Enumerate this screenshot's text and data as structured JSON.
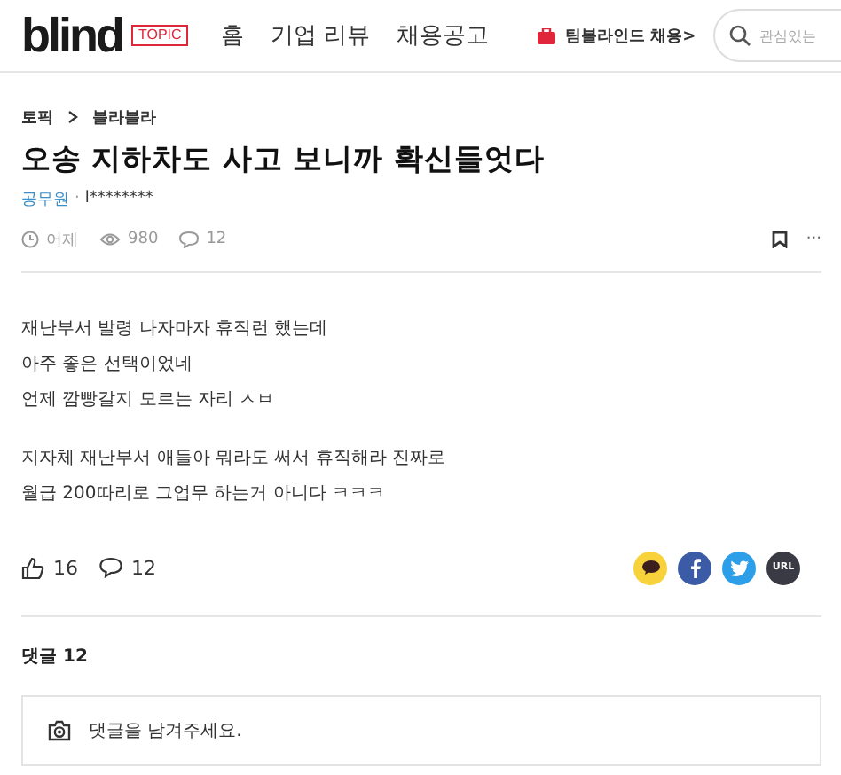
{
  "header": {
    "logo": "blind",
    "logo_tag": "TOPIC",
    "nav": [
      {
        "label": "홈",
        "selected": false
      },
      {
        "label": "기업 리뷰",
        "selected": false
      },
      {
        "label": "채용공고",
        "selected": false
      }
    ],
    "promo": "팀블라인드 채용>",
    "search": {
      "placeholder": "관심있는"
    }
  },
  "breadcrumb": [
    "토픽",
    "블라블라"
  ],
  "title": "오송 지하차도 사고 보니까 확신들엇다",
  "author": {
    "company": "공무원",
    "separator": "·",
    "name": "l********"
  },
  "stats": {
    "time": "어제",
    "views": "980",
    "comments": "12"
  },
  "more": "···",
  "body": [
    [
      "재난부서 발령 나자마자 휴직런 했는데",
      "아주 좋은 선택이었네",
      "언제 깜빵갈지 모르는 자리 ㅅㅂ"
    ],
    [
      "지자체 재난부서 애들아 뭐라도 써서 휴직해라 진짜로",
      "월급 200따리로 그업무 하는거 아니다 ㅋㅋㅋ"
    ]
  ],
  "actions": {
    "likes": "16",
    "comments": "12"
  },
  "share": [
    {
      "kind": "kakao"
    },
    {
      "kind": "facebook"
    },
    {
      "kind": "twitter"
    },
    {
      "kind": "url",
      "label": "URL"
    }
  ],
  "comments_header": "댓글 12",
  "comment_box": {
    "placeholder": "댓글을 남겨주세요."
  }
}
